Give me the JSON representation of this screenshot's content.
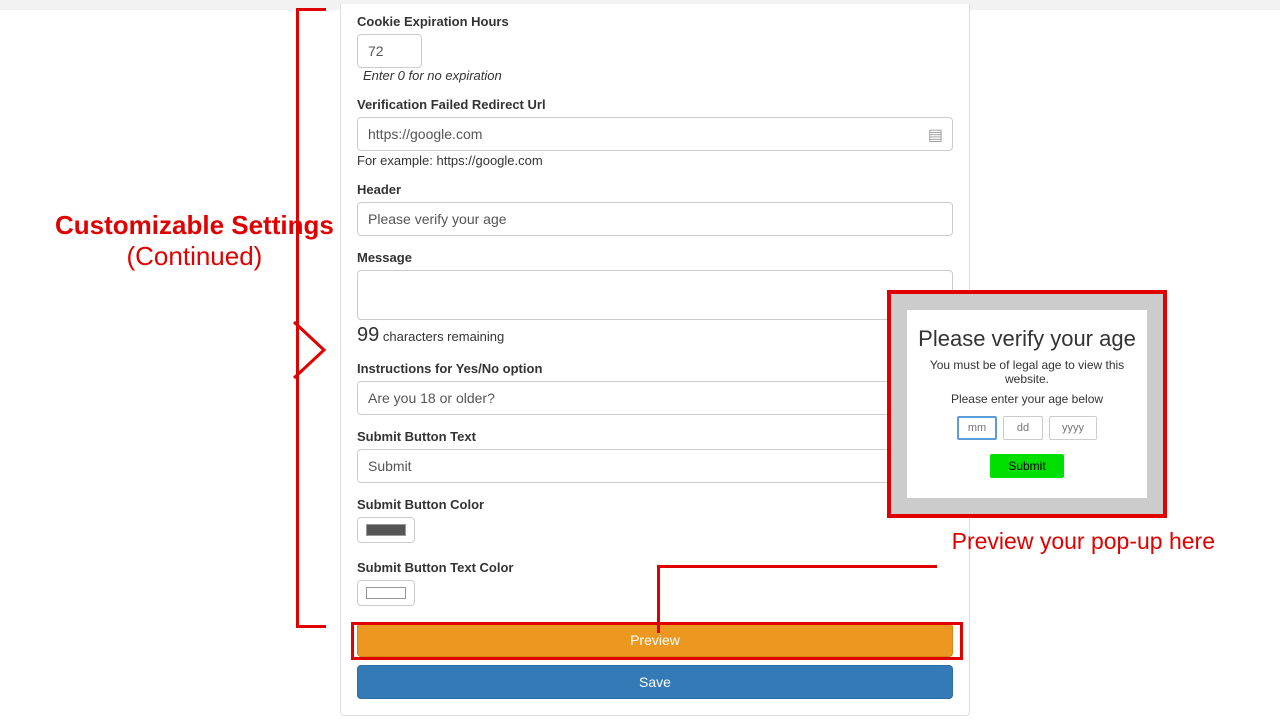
{
  "annotations": {
    "left_bold": "Customizable Settings",
    "left_normal": "(Continued)",
    "preview_here": "Preview your pop-up here"
  },
  "fields": {
    "cookie_hours": {
      "label": "Cookie Expiration Hours",
      "value": "72",
      "help": "Enter 0 for no expiration"
    },
    "redirect_url": {
      "label": "Verification Failed Redirect Url",
      "value": "https://google.com",
      "help": "For example: https://google.com"
    },
    "header": {
      "label": "Header",
      "value": "Please verify your age"
    },
    "message": {
      "label": "Message",
      "value": "",
      "remaining_count": "99",
      "remaining_text": "characters remaining"
    },
    "instructions": {
      "label": "Instructions for Yes/No option",
      "value": "Are you 18 or older?"
    },
    "submit_text": {
      "label": "Submit Button Text",
      "value": "Submit"
    },
    "submit_color": {
      "label": "Submit Button Color",
      "value": "#555555"
    },
    "submit_text_color": {
      "label": "Submit Button Text Color",
      "value": "#ffffff"
    }
  },
  "buttons": {
    "preview": "Preview",
    "save": "Save"
  },
  "popup": {
    "title": "Please verify your age",
    "message": "You must be of legal age to view this website.",
    "sub": "Please enter your age below",
    "mm": "mm",
    "dd": "dd",
    "yyyy": "yyyy",
    "submit": "Submit"
  }
}
